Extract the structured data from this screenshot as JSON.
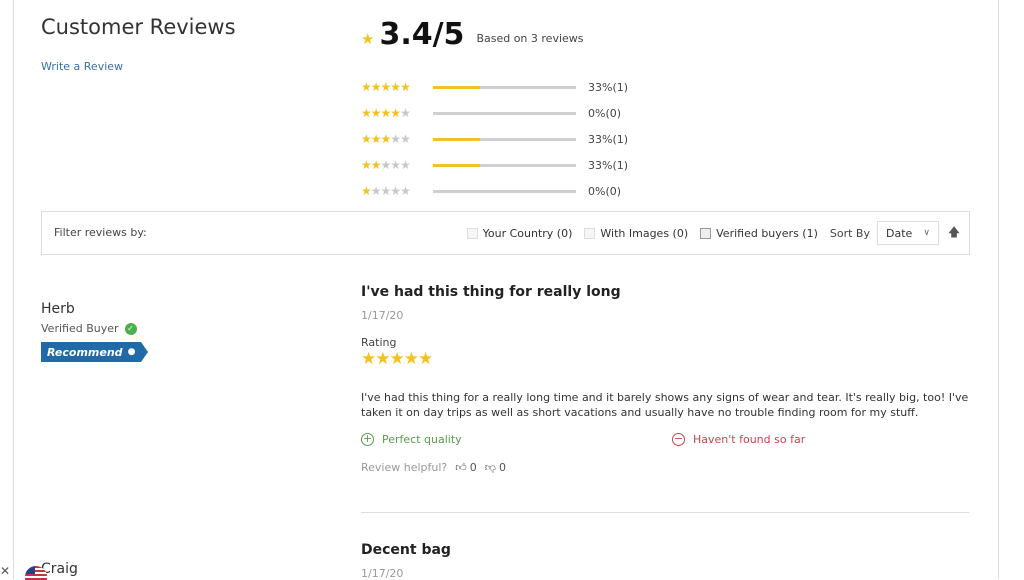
{
  "header": {
    "title": "Customer Reviews",
    "write_review": "Write a Review"
  },
  "summary": {
    "average": "3.4/5",
    "based_on": "Based on 3 reviews",
    "distribution": [
      {
        "stars": 5,
        "percent": 33,
        "label": "33%(1)"
      },
      {
        "stars": 4,
        "percent": 0,
        "label": "0%(0)"
      },
      {
        "stars": 3,
        "percent": 33,
        "label": "33%(1)"
      },
      {
        "stars": 2,
        "percent": 33,
        "label": "33%(1)"
      },
      {
        "stars": 1,
        "percent": 0,
        "label": "0%(0)"
      }
    ]
  },
  "filter": {
    "label": "Filter reviews by:",
    "options": [
      {
        "label": "Your Country (0)",
        "checked": false
      },
      {
        "label": "With Images (0)",
        "checked": false
      },
      {
        "label": "Verified buyers (1)",
        "checked": false
      }
    ],
    "sort_by": "Sort By",
    "sort_value": "Date"
  },
  "reviews": [
    {
      "author": "Herb",
      "verified": "Verified Buyer",
      "badge": "Recommend",
      "title": "I've had this thing for really long",
      "date": "1/17/20",
      "rating_label": "Rating",
      "rating": 5,
      "body": "I've had this thing for a really long time and it barely shows any signs of wear and tear. It's really big, too! I've taken it on day trips as well as short vacations and usually have no trouble finding room for my stuff.",
      "pros": "Perfect quality",
      "cons": "Haven't found so far",
      "helpful_label": "Review helpful?",
      "up": "0",
      "down": "0"
    },
    {
      "author": "Craig",
      "title": "Decent bag",
      "date": "1/17/20"
    }
  ],
  "colors": {
    "star": "#f2c320",
    "link": "#3a6ea8",
    "badge": "#1f6aa7",
    "pros": "#5a9a4e",
    "cons": "#c9444d"
  }
}
